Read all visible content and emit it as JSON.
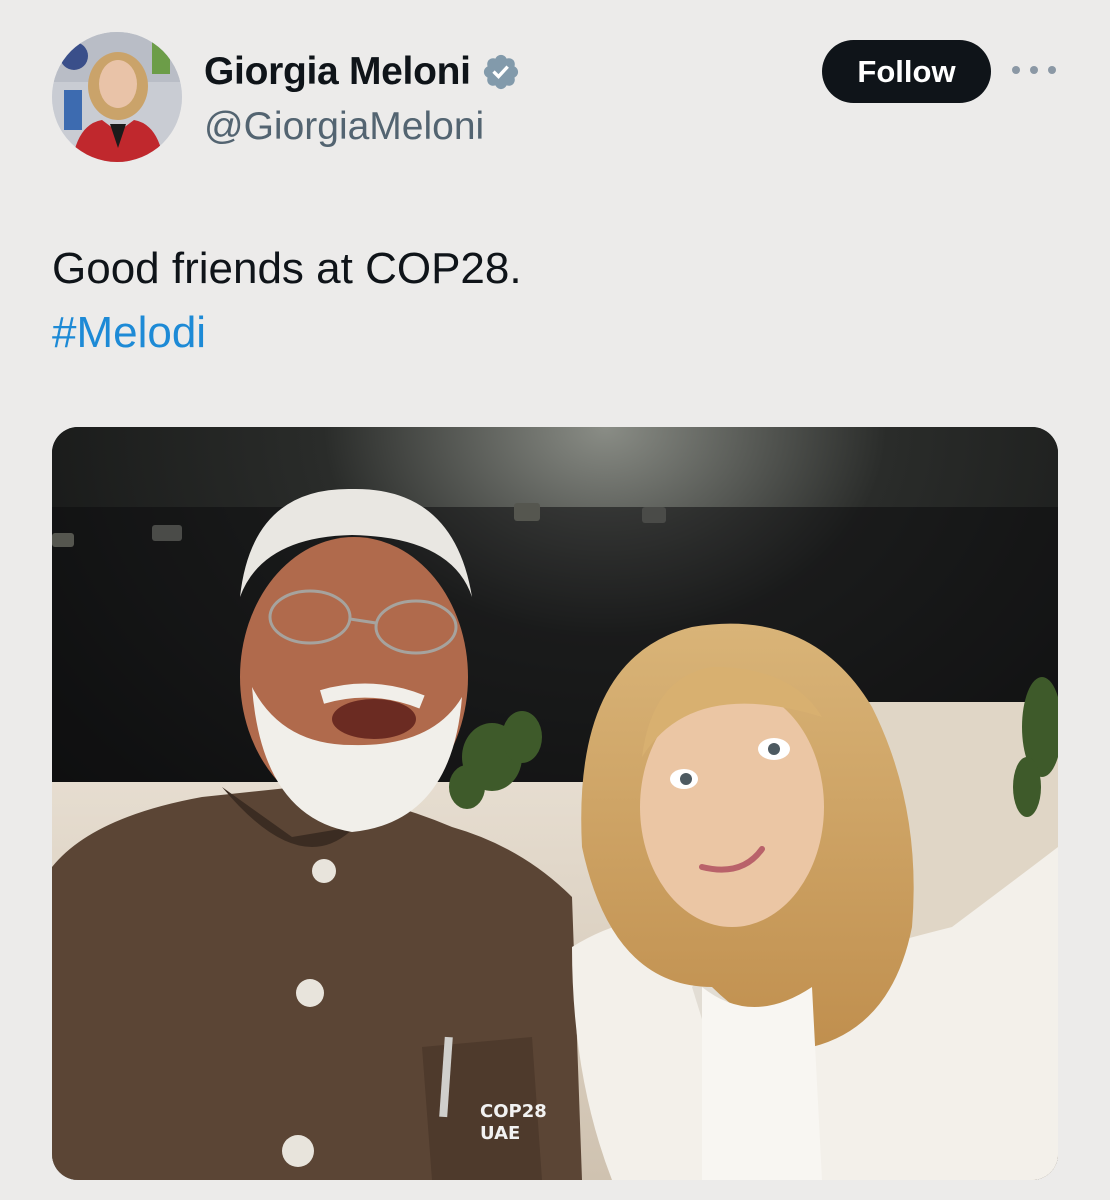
{
  "author": {
    "display_name": "Giorgia Meloni",
    "handle": "@GiorgiaMeloni",
    "verified": true,
    "verified_icon": "verified-badge-icon"
  },
  "actions": {
    "follow_label": "Follow",
    "more_icon": "more-horizontal-icon"
  },
  "tweet": {
    "text": "Good friends at COP28.",
    "hashtag": "#Melodi"
  },
  "media": {
    "badge_line1": "COP28",
    "badge_line2": "UAE"
  },
  "colors": {
    "background": "#ecebea",
    "text": "#0f1419",
    "secondary_text": "#536471",
    "link": "#1d8ad6",
    "follow_button": "#0f1419"
  }
}
